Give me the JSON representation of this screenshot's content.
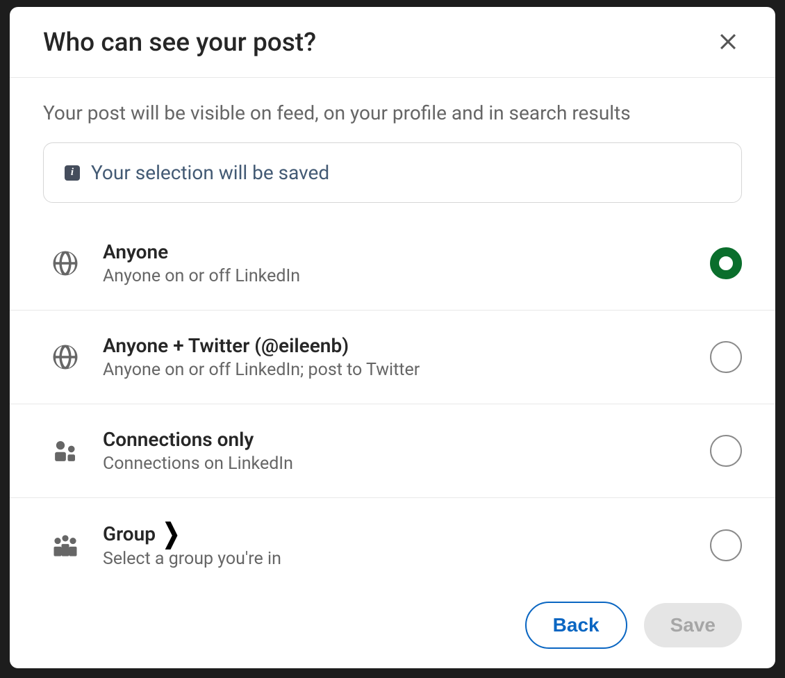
{
  "modal": {
    "title": "Who can see your post?",
    "subtitle": "Your post will be visible on feed, on your profile and in search results",
    "info": "Your selection will be saved"
  },
  "options": [
    {
      "title": "Anyone",
      "desc": "Anyone on or off LinkedIn",
      "icon": "globe-icon",
      "selected": true
    },
    {
      "title": "Anyone + Twitter (@eileenb)",
      "desc": "Anyone on or off LinkedIn; post to Twitter",
      "icon": "globe-icon",
      "selected": false
    },
    {
      "title": "Connections only",
      "desc": "Connections on LinkedIn",
      "icon": "connections-icon",
      "selected": false
    },
    {
      "title": "Group",
      "desc": "Select a group you're in",
      "icon": "group-icon",
      "selected": false,
      "has_chevron": true
    }
  ],
  "footer": {
    "back": "Back",
    "save": "Save"
  }
}
